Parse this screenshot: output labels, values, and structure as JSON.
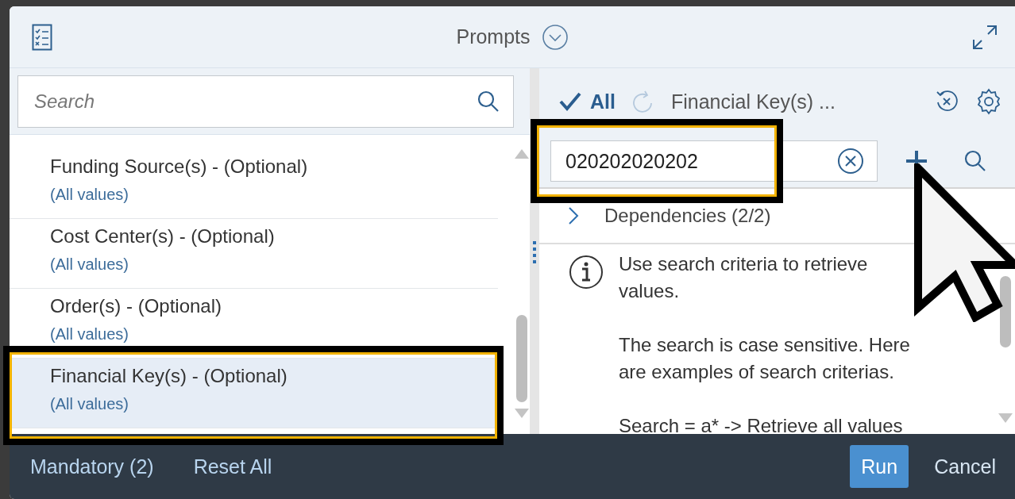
{
  "dialog": {
    "title": "Prompts"
  },
  "left_panel": {
    "search": {
      "placeholder": "Search"
    },
    "prompts": [
      {
        "name": "Funding Source(s) - (Optional)",
        "value": "(All values)",
        "selected": false
      },
      {
        "name": "Cost Center(s) - (Optional)",
        "value": "(All values)",
        "selected": false
      },
      {
        "name": "Order(s) - (Optional)",
        "value": "(All values)",
        "selected": false
      },
      {
        "name": "Financial Key(s) - (Optional)",
        "value": "(All values)",
        "selected": true
      }
    ]
  },
  "right_panel": {
    "toolbar": {
      "all_label": "All",
      "current_prompt": "Financial Key(s) ..."
    },
    "value_input": {
      "value": "020202020202"
    },
    "dependencies": {
      "label": "Dependencies (2/2)",
      "expanded": false
    },
    "info": {
      "paragraphs": [
        "Use search criteria to retrieve values.",
        "The search is case sensitive. Here are examples of search criterias.",
        "Search = a* -> Retrieve all values"
      ]
    }
  },
  "footer": {
    "links": [
      "Mandatory (2)",
      "Reset All"
    ],
    "buttons": [
      {
        "label": "Run",
        "kind": "primary"
      },
      {
        "label": "Cancel",
        "kind": "plain"
      }
    ]
  }
}
